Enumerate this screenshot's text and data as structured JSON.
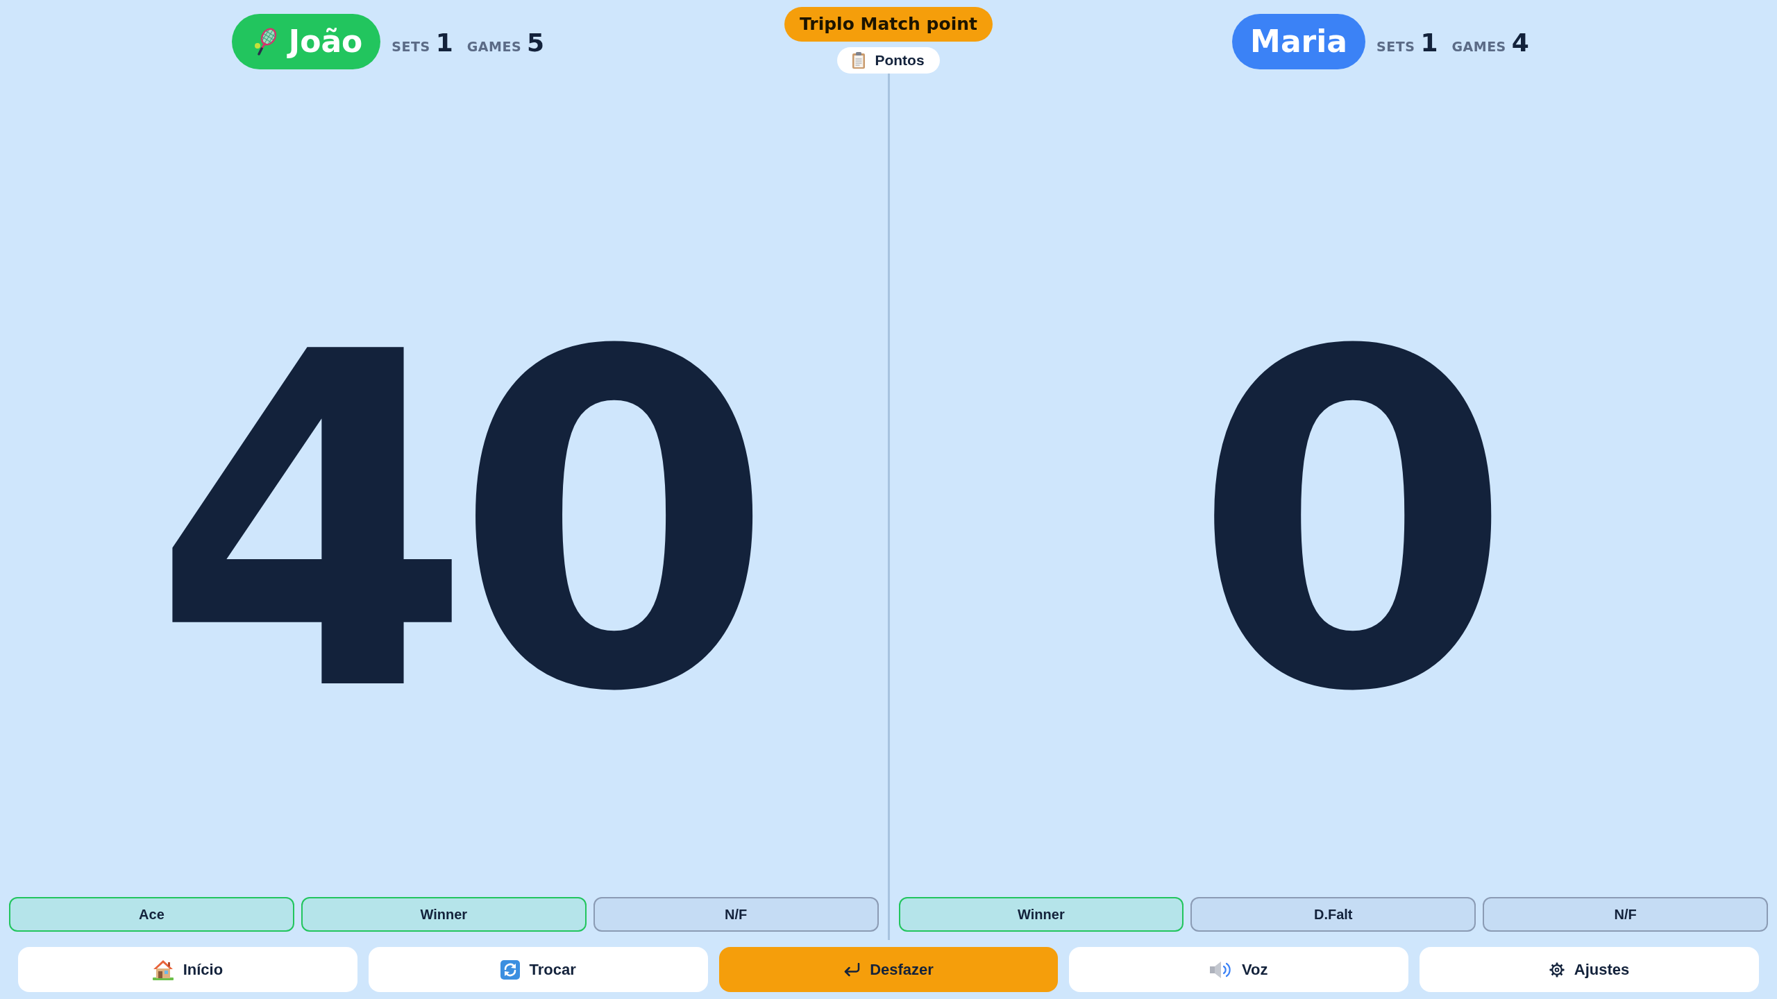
{
  "players": [
    {
      "name": "João",
      "color": "#22c55e",
      "serving": true,
      "sets_label": "SETS",
      "sets": "1",
      "games_label": "GAMES",
      "games": "5",
      "score": "40",
      "actions": [
        {
          "label": "Ace",
          "kind": "positive"
        },
        {
          "label": "Winner",
          "kind": "positive"
        },
        {
          "label": "N/F",
          "kind": "neutral"
        }
      ]
    },
    {
      "name": "Maria",
      "color": "#3b82f6",
      "serving": false,
      "sets_label": "SETS",
      "sets": "1",
      "games_label": "GAMES",
      "games": "4",
      "score": "0",
      "actions": [
        {
          "label": "Winner",
          "kind": "positive"
        },
        {
          "label": "D.Falt",
          "kind": "neutral"
        },
        {
          "label": "N/F",
          "kind": "neutral"
        }
      ]
    }
  ],
  "status_banner": "Triplo Match point",
  "points_button": "Pontos",
  "toolbar": [
    {
      "label": "Início",
      "kind": "plain"
    },
    {
      "label": "Trocar",
      "kind": "plain"
    },
    {
      "label": "Desfazer",
      "kind": "primary"
    },
    {
      "label": "Voz",
      "kind": "plain"
    },
    {
      "label": "Ajustes",
      "kind": "plain"
    }
  ]
}
